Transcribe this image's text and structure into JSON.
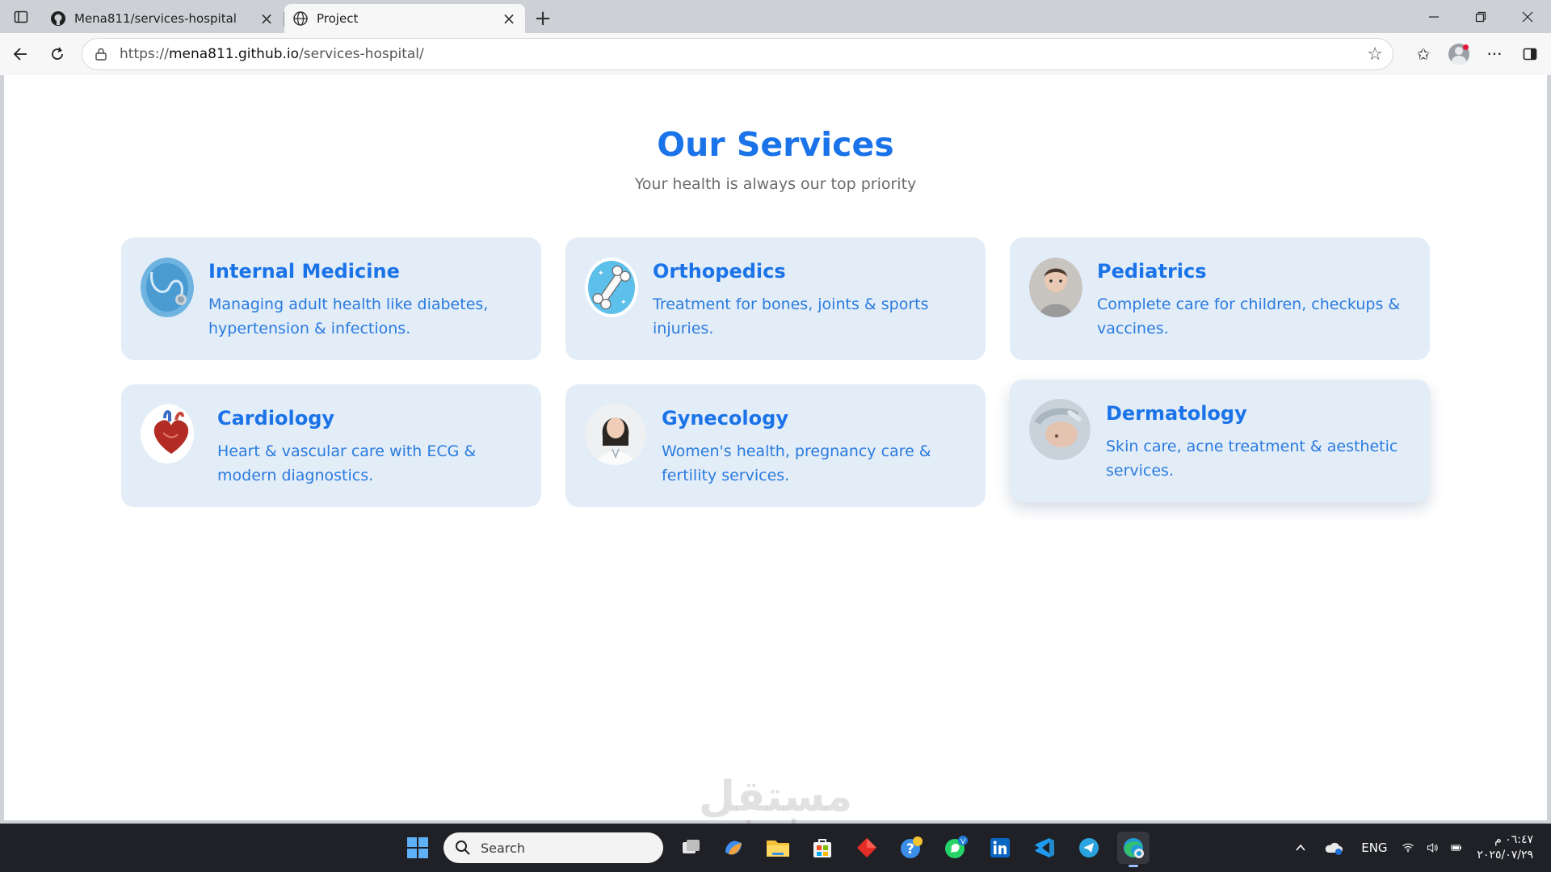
{
  "browser": {
    "tabs": [
      {
        "title": "Mena811/services-hospital",
        "active": false,
        "icon": "github-icon"
      },
      {
        "title": "Project",
        "active": true,
        "icon": "globe-icon"
      }
    ],
    "url": {
      "scheme": "https://",
      "host": "mena811.github.io",
      "path": "/services-hospital/"
    }
  },
  "page": {
    "title": "Our Services",
    "subtitle": "Your health is always our top priority",
    "services": [
      {
        "title": "Internal Medicine",
        "description": "Managing adult health like diabetes, hypertension & infections.",
        "image": "stethoscope-image"
      },
      {
        "title": "Orthopedics",
        "description": "Treatment for bones, joints & sports injuries.",
        "image": "bone-image"
      },
      {
        "title": "Pediatrics",
        "description": "Complete care for children, checkups & vaccines.",
        "image": "child-image"
      },
      {
        "title": "Cardiology",
        "description": "Heart & vascular care with ECG & modern diagnostics.",
        "image": "heart-image"
      },
      {
        "title": "Gynecology",
        "description": "Women's health, pregnancy care & fertility services.",
        "image": "doctor-image"
      },
      {
        "title": "Dermatology",
        "description": "Skin care, acne treatment & aesthetic services.",
        "image": "skincare-image"
      }
    ]
  },
  "watermark": {
    "arabic": "مستقل",
    "latin": "mostaql.com"
  },
  "taskbar": {
    "search_placeholder": "Search",
    "language": "ENG",
    "time": "٠٦:٤٧ م",
    "date": "٢٠٢٥/٠٧/٢٩"
  },
  "colors": {
    "accent": "#1a73e8",
    "card_bg": "#e3edf8",
    "subtitle": "#6b6b6b"
  }
}
